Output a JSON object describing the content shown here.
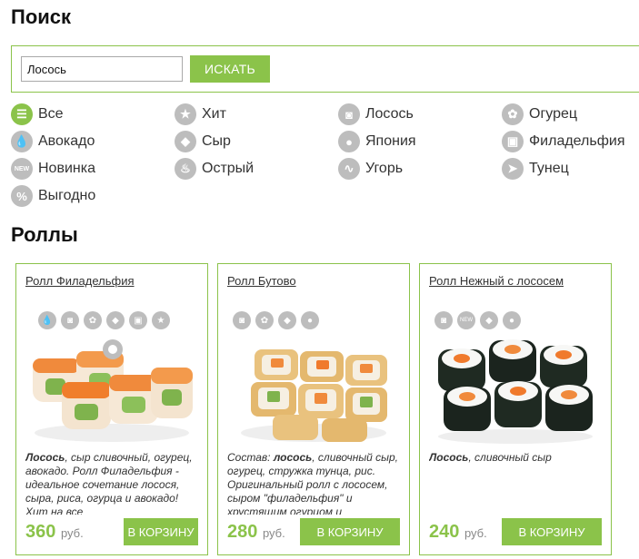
{
  "search": {
    "title": "Поиск",
    "query": "Лосось",
    "button": "ИСКАТЬ"
  },
  "filters": [
    {
      "label": "Все",
      "icon": "list-icon",
      "active": true
    },
    {
      "label": "Хит",
      "icon": "star-icon"
    },
    {
      "label": "Лосось",
      "icon": "salmon-icon"
    },
    {
      "label": "Огурец",
      "icon": "cucumber-icon"
    },
    {
      "label": "Авокадо",
      "icon": "avocado-icon"
    },
    {
      "label": "Сыр",
      "icon": "cheese-icon"
    },
    {
      "label": "Япония",
      "icon": "japan-icon"
    },
    {
      "label": "Филадельфия",
      "icon": "philadelphia-icon"
    },
    {
      "label": "Новинка",
      "icon": "new-icon"
    },
    {
      "label": "Острый",
      "icon": "spicy-icon"
    },
    {
      "label": "Угорь",
      "icon": "eel-icon"
    },
    {
      "label": "Тунец",
      "icon": "tuna-icon"
    },
    {
      "label": "Выгодно",
      "icon": "percent-icon"
    }
  ],
  "rolls": {
    "title": "Роллы",
    "products": [
      {
        "name": "Ролл Филадельфия",
        "tags": [
          "avocado-icon",
          "salmon-icon",
          "cucumber-icon",
          "cheese-icon",
          "philadelphia-icon",
          "star-icon"
        ],
        "description_bold": "Лосось",
        "description": ", сыр сливочный, огурец, авокадо. Ролл Филадельфия - идеальное сочетание лосося, сыра, риса, огурца и авокадо! Хит на все",
        "price": "360",
        "currency": "руб.",
        "button": "В КОРЗИНУ",
        "accent": "#f08a3c"
      },
      {
        "name": "Ролл Бутово",
        "tags": [
          "salmon-icon",
          "cucumber-icon",
          "cheese-icon",
          "japan-icon"
        ],
        "description_prefix": "Состав: ",
        "description_bold": "лосось",
        "description": ", сливочный сыр, огурец, стружка тунца, рис. Оригинальный ролл с лососем, сыром \"филадельфия\" и хрустящим огурцом и",
        "price": "280",
        "currency": "руб.",
        "button": "В КОРЗИНУ",
        "accent": "#e0b060"
      },
      {
        "name": "Ролл Нежный с лососем",
        "tags": [
          "salmon-icon",
          "new-icon",
          "cheese-icon",
          "japan-icon"
        ],
        "description_bold": "Лосось",
        "description": ", сливочный сыр",
        "price": "240",
        "currency": "руб.",
        "button": "В КОРЗИНУ",
        "accent": "#f07a2c"
      }
    ]
  }
}
